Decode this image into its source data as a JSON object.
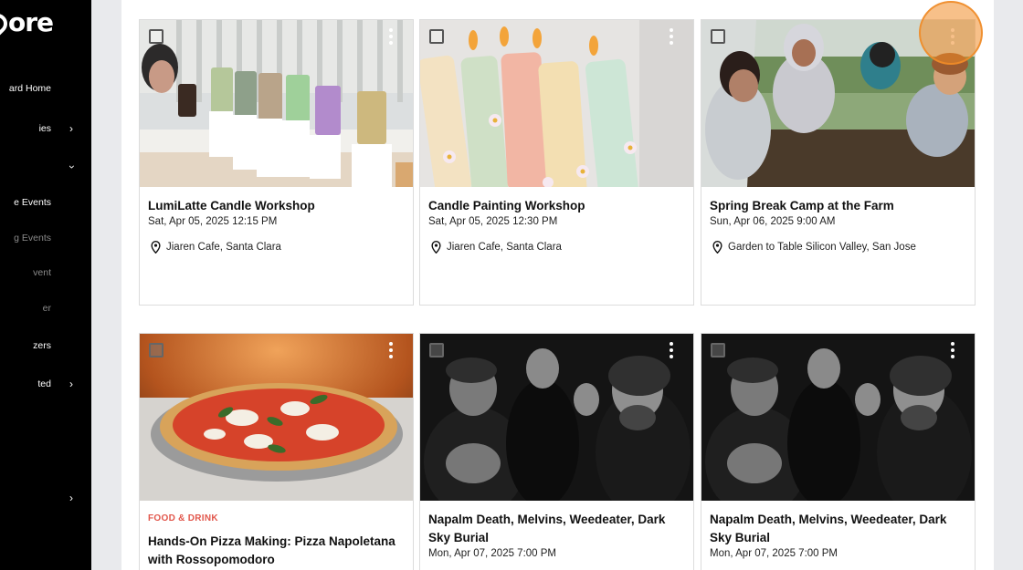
{
  "sidebar": {
    "logo_text": "ore",
    "items": [
      {
        "label": "ard Home",
        "chevron": ""
      },
      {
        "label": "ies",
        "chevron": "right"
      },
      {
        "label": "",
        "chevron": "down"
      },
      {
        "label": "e Events",
        "chevron": ""
      },
      {
        "label": "g Events",
        "chevron": "",
        "dim": true
      },
      {
        "label": "vent",
        "chevron": "",
        "dim": true
      },
      {
        "label": "er",
        "chevron": "",
        "dim": true
      },
      {
        "label": "zers",
        "chevron": ""
      },
      {
        "label": "ted",
        "chevron": "right"
      },
      {
        "label": "",
        "chevron": "right"
      }
    ]
  },
  "events": [
    {
      "title": "LumiLatte Candle Workshop",
      "date": "Sat, Apr 05, 2025 12:15 PM",
      "location": "Jiaren Cafe, Santa Clara",
      "category": ""
    },
    {
      "title": "Candle Painting Workshop",
      "date": "Sat, Apr 05, 2025 12:30 PM",
      "location": "Jiaren Cafe, Santa Clara",
      "category": ""
    },
    {
      "title": "Spring Break Camp at the Farm",
      "date": "Sun, Apr 06, 2025 9:00 AM",
      "location": "Garden to Table Silicon Valley, San Jose",
      "category": ""
    },
    {
      "title": "Hands-On Pizza Making: Pizza Napoletana with Rossopomodoro",
      "date": "",
      "location": "",
      "category": "FOOD & DRINK"
    },
    {
      "title": "Napalm Death, Melvins, Weedeater, Dark Sky Burial",
      "date": "Mon, Apr 07, 2025 7:00 PM",
      "location": "",
      "category": ""
    },
    {
      "title": "Napalm Death, Melvins, Weedeater, Dark Sky Burial",
      "date": "Mon, Apr 07, 2025 7:00 PM",
      "location": "",
      "category": ""
    }
  ],
  "icons": {
    "location": "map-pin-icon",
    "menu": "kebab-menu-icon",
    "select": "checkbox-icon",
    "chevron_right": "chevron-right-icon",
    "chevron_down": "chevron-down-icon"
  },
  "colors": {
    "sidebar_bg": "#000000",
    "category": "#e2574c",
    "cursor_highlight": "#f08c28"
  }
}
